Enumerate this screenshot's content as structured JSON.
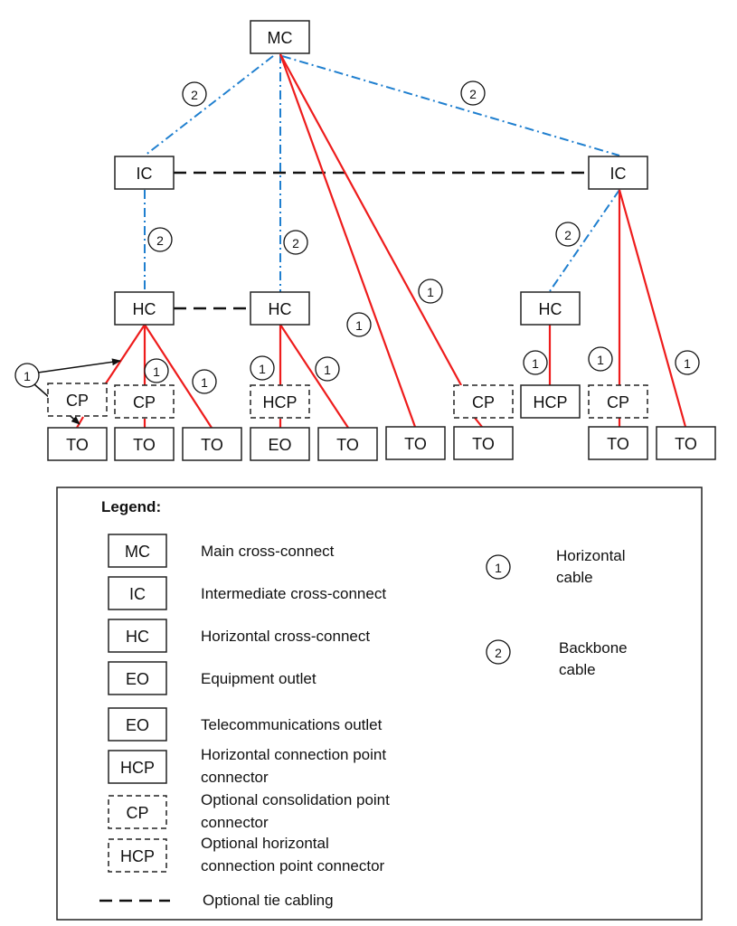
{
  "colors": {
    "horizontal_cable": "#ee1c1c",
    "backbone_cable": "#1f7fcf",
    "tie_cabling": "#111111"
  },
  "nodes": {
    "mc": "MC",
    "ic_left": "IC",
    "ic_right": "IC",
    "hc_left": "HC",
    "hc_mid": "HC",
    "hc_right": "HC",
    "cp_1": "CP",
    "cp_2": "CP",
    "hcp_opt": "HCP",
    "cp_3": "CP",
    "hcp_right": "HCP",
    "cp_4": "CP",
    "to_1": "TO",
    "to_2": "TO",
    "to_3": "TO",
    "eo": "EO",
    "to_4": "TO",
    "to_5": "TO",
    "to_6": "TO",
    "to_7": "TO",
    "to_8": "TO"
  },
  "cable_markers": {
    "horizontal": "1",
    "backbone": "2"
  },
  "legend": {
    "title": "Legend:",
    "items": [
      {
        "symbol": "MC",
        "text": [
          "Main cross-connect"
        ]
      },
      {
        "symbol": "IC",
        "text": [
          "Intermediate cross-connect"
        ]
      },
      {
        "symbol": "HC",
        "text": [
          "Horizontal cross-connect"
        ]
      },
      {
        "symbol": "EO",
        "text": [
          "Equipment outlet"
        ]
      },
      {
        "symbol": "EO",
        "text": [
          "Telecommunications outlet"
        ]
      },
      {
        "symbol": "HCP",
        "text": [
          "Horizontal connection point",
          "connector"
        ]
      },
      {
        "symbol": "CP",
        "text": [
          "Optional consolidation point",
          "connector"
        ]
      },
      {
        "symbol": "HCP",
        "text": [
          "Optional horizontal",
          "connection point connector"
        ]
      }
    ],
    "tie_text": "Optional tie cabling",
    "cables": [
      {
        "marker": "1",
        "text": [
          "Horizontal",
          "cable"
        ]
      },
      {
        "marker": "2",
        "text": [
          "Backbone",
          "cable"
        ]
      }
    ]
  }
}
